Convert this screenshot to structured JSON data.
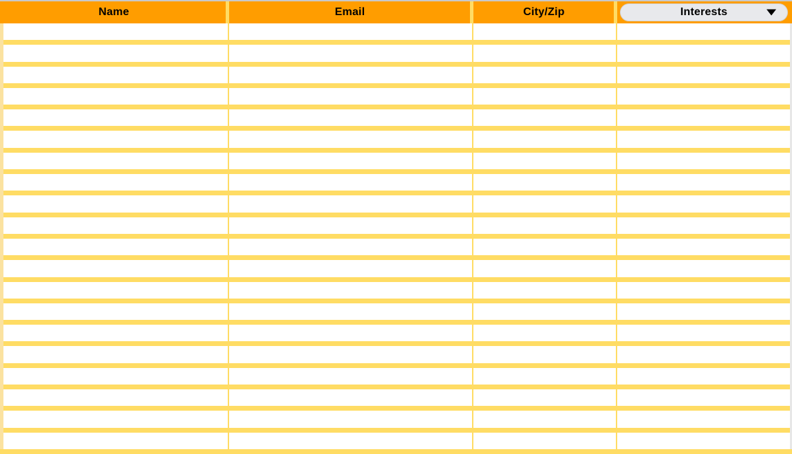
{
  "table": {
    "columns": [
      {
        "key": "name",
        "label": "Name",
        "type": "text"
      },
      {
        "key": "email",
        "label": "Email",
        "type": "text"
      },
      {
        "key": "city_zip",
        "label": "City/Zip",
        "type": "text"
      },
      {
        "key": "interests",
        "label": "Interests",
        "type": "dropdown"
      }
    ],
    "interests_dropdown": {
      "label": "Interests",
      "icon": "chevron-down-icon",
      "expanded": false
    },
    "row_count": 20,
    "rows": [
      {
        "name": "",
        "email": "",
        "city_zip": "",
        "interests": ""
      },
      {
        "name": "",
        "email": "",
        "city_zip": "",
        "interests": ""
      },
      {
        "name": "",
        "email": "",
        "city_zip": "",
        "interests": ""
      },
      {
        "name": "",
        "email": "",
        "city_zip": "",
        "interests": ""
      },
      {
        "name": "",
        "email": "",
        "city_zip": "",
        "interests": ""
      },
      {
        "name": "",
        "email": "",
        "city_zip": "",
        "interests": ""
      },
      {
        "name": "",
        "email": "",
        "city_zip": "",
        "interests": ""
      },
      {
        "name": "",
        "email": "",
        "city_zip": "",
        "interests": ""
      },
      {
        "name": "",
        "email": "",
        "city_zip": "",
        "interests": ""
      },
      {
        "name": "",
        "email": "",
        "city_zip": "",
        "interests": ""
      },
      {
        "name": "",
        "email": "",
        "city_zip": "",
        "interests": ""
      },
      {
        "name": "",
        "email": "",
        "city_zip": "",
        "interests": ""
      },
      {
        "name": "",
        "email": "",
        "city_zip": "",
        "interests": ""
      },
      {
        "name": "",
        "email": "",
        "city_zip": "",
        "interests": ""
      },
      {
        "name": "",
        "email": "",
        "city_zip": "",
        "interests": ""
      },
      {
        "name": "",
        "email": "",
        "city_zip": "",
        "interests": ""
      },
      {
        "name": "",
        "email": "",
        "city_zip": "",
        "interests": ""
      },
      {
        "name": "",
        "email": "",
        "city_zip": "",
        "interests": ""
      },
      {
        "name": "",
        "email": "",
        "city_zip": "",
        "interests": ""
      },
      {
        "name": "",
        "email": "",
        "city_zip": "",
        "interests": ""
      }
    ]
  },
  "colors": {
    "header_background": "#ff9d00",
    "header_text": "#000000",
    "row_separator": "#ffdc64",
    "row_background": "#ffffff",
    "dropdown_background": "#e8e9ec",
    "frame_edge": "#fbe2a0"
  }
}
